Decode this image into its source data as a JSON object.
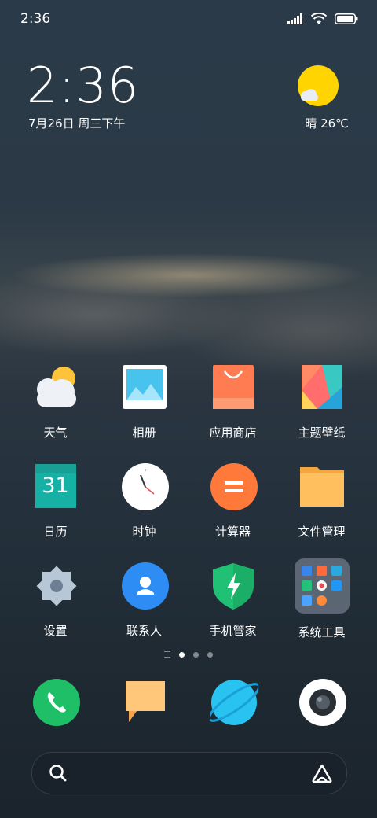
{
  "status_bar": {
    "time": "2:36"
  },
  "clock_widget": {
    "time": "2:36",
    "date": "7月26日 周三下午"
  },
  "weather_widget": {
    "condition": "晴",
    "temperature": "26℃"
  },
  "apps": [
    {
      "label": "天气",
      "icon": "weather-icon"
    },
    {
      "label": "相册",
      "icon": "gallery-icon"
    },
    {
      "label": "应用商店",
      "icon": "app-store-icon"
    },
    {
      "label": "主题壁纸",
      "icon": "themes-icon"
    },
    {
      "label": "日历",
      "icon": "calendar-icon",
      "badge": "31"
    },
    {
      "label": "时钟",
      "icon": "clock-icon"
    },
    {
      "label": "计算器",
      "icon": "calculator-icon"
    },
    {
      "label": "文件管理",
      "icon": "file-manager-icon"
    },
    {
      "label": "设置",
      "icon": "settings-icon"
    },
    {
      "label": "联系人",
      "icon": "contacts-icon"
    },
    {
      "label": "手机管家",
      "icon": "security-icon"
    },
    {
      "label": "系统工具",
      "icon": "system-tools-folder-icon"
    }
  ],
  "page_indicator": {
    "pages": 3,
    "active": 0
  },
  "dock": [
    {
      "icon": "phone-icon"
    },
    {
      "icon": "messages-icon"
    },
    {
      "icon": "browser-icon"
    },
    {
      "icon": "camera-icon"
    }
  ],
  "colors": {
    "phone": "#1fbf68",
    "messages": "#ffc779",
    "browser": "#29c3f2",
    "contacts": "#2e8cf5",
    "calculator": "#ff7a3a",
    "calendar": "#16b1a4",
    "files": "#ffb84e",
    "security": "#20c174",
    "weather_sun": "#ffd400"
  }
}
